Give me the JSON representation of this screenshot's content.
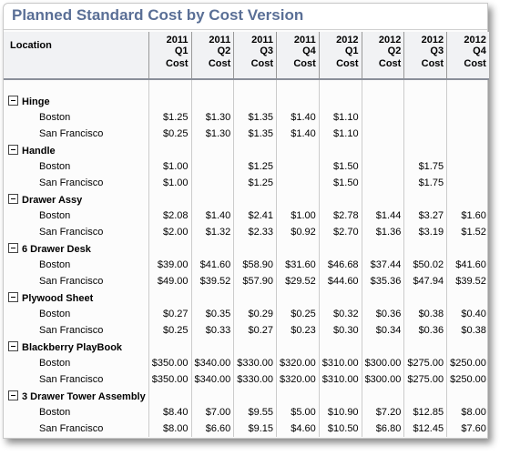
{
  "title": "Planned Standard Cost by Cost Version",
  "header": {
    "location_label": "Location",
    "periods": [
      "2011 Q1",
      "2011 Q2",
      "2011 Q3",
      "2011 Q4",
      "2012 Q1",
      "2012 Q2",
      "2012 Q3",
      "2012 Q4"
    ],
    "measure_label": "Cost"
  },
  "groups": [
    {
      "name": "Hinge",
      "rows": [
        {
          "location": "Boston",
          "values": [
            "$1.25",
            "$1.30",
            "$1.35",
            "$1.40",
            "$1.10",
            "",
            "",
            ""
          ]
        },
        {
          "location": "San Francisco",
          "values": [
            "$0.25",
            "$1.30",
            "$1.35",
            "$1.40",
            "$1.10",
            "",
            "",
            ""
          ]
        }
      ]
    },
    {
      "name": "Handle",
      "rows": [
        {
          "location": "Boston",
          "values": [
            "$1.00",
            "",
            "$1.25",
            "",
            "$1.50",
            "",
            "$1.75",
            ""
          ]
        },
        {
          "location": "San Francisco",
          "values": [
            "$1.00",
            "",
            "$1.25",
            "",
            "$1.50",
            "",
            "$1.75",
            ""
          ]
        }
      ]
    },
    {
      "name": "Drawer Assy",
      "rows": [
        {
          "location": "Boston",
          "values": [
            "$2.08",
            "$1.40",
            "$2.41",
            "$1.00",
            "$2.78",
            "$1.44",
            "$3.27",
            "$1.60"
          ]
        },
        {
          "location": "San Francisco",
          "values": [
            "$2.00",
            "$1.32",
            "$2.33",
            "$0.92",
            "$2.70",
            "$1.36",
            "$3.19",
            "$1.52"
          ]
        }
      ]
    },
    {
      "name": "6 Drawer Desk",
      "rows": [
        {
          "location": "Boston",
          "values": [
            "$39.00",
            "$41.60",
            "$58.90",
            "$31.60",
            "$46.68",
            "$37.44",
            "$50.02",
            "$41.60"
          ]
        },
        {
          "location": "San Francisco",
          "values": [
            "$49.00",
            "$39.52",
            "$57.90",
            "$29.52",
            "$44.60",
            "$35.36",
            "$47.94",
            "$39.52"
          ]
        }
      ]
    },
    {
      "name": "Plywood Sheet",
      "rows": [
        {
          "location": "Boston",
          "values": [
            "$0.27",
            "$0.35",
            "$0.29",
            "$0.25",
            "$0.32",
            "$0.36",
            "$0.38",
            "$0.40"
          ]
        },
        {
          "location": "San Francisco",
          "values": [
            "$0.25",
            "$0.33",
            "$0.27",
            "$0.23",
            "$0.30",
            "$0.34",
            "$0.36",
            "$0.38"
          ]
        }
      ]
    },
    {
      "name": "Blackberry PlayBook",
      "rows": [
        {
          "location": "Boston",
          "values": [
            "$350.00",
            "$340.00",
            "$330.00",
            "$320.00",
            "$310.00",
            "$300.00",
            "$275.00",
            "$250.00"
          ]
        },
        {
          "location": "San Francisco",
          "values": [
            "$350.00",
            "$340.00",
            "$330.00",
            "$320.00",
            "$310.00",
            "$300.00",
            "$275.00",
            "$250.00"
          ]
        }
      ]
    },
    {
      "name": "3 Drawer Tower Assembly",
      "rows": [
        {
          "location": "Boston",
          "values": [
            "$8.40",
            "$7.00",
            "$9.55",
            "$5.00",
            "$10.90",
            "$7.20",
            "$12.85",
            "$8.00"
          ]
        },
        {
          "location": "San Francisco",
          "values": [
            "$8.00",
            "$6.60",
            "$9.15",
            "$4.60",
            "$10.50",
            "$6.80",
            "$12.45",
            "$7.60"
          ]
        }
      ]
    }
  ]
}
